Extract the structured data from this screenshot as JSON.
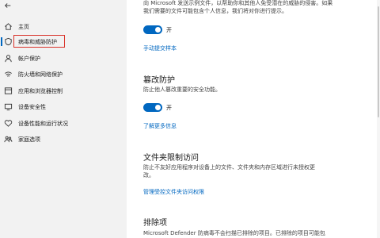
{
  "sidebar": {
    "items": [
      {
        "label": "主页",
        "icon": "home-icon"
      },
      {
        "label": "病毒和威胁防护",
        "icon": "shield-icon"
      },
      {
        "label": "帐户保护",
        "icon": "person-icon"
      },
      {
        "label": "防火墙和网络保护",
        "icon": "wifi-icon"
      },
      {
        "label": "应用和浏览器控制",
        "icon": "app-window-icon"
      },
      {
        "label": "设备安全性",
        "icon": "device-icon"
      },
      {
        "label": "设备性能和运行状况",
        "icon": "heart-icon"
      },
      {
        "label": "家庭选项",
        "icon": "family-icon"
      }
    ],
    "active_index": 1
  },
  "main": {
    "sample_desc_line1": "向 Microsoft 发送示例文件，以帮助你和其他人免受潜在的威胁的侵害。如果",
    "sample_desc_line2": "我们需要的文件可能包含个人信息，我们将对你进行提示。",
    "sample_toggle_label": "开",
    "sample_link": "手动提交样本",
    "tamper_title": "篡改防护",
    "tamper_desc": "防止他人篡改重要的安全功能。",
    "tamper_toggle_label": "开",
    "tamper_link": "了解更多信息",
    "folder_title": "文件夹限制访问",
    "folder_desc_line1": "防止不友好应用程序对设备上的文件、文件夹和内存区域进行未授权更",
    "folder_desc_line2": "改。",
    "folder_link": "管理受控文件夹访问权限",
    "exclusions_title": "排除项",
    "exclusions_desc": "Microsoft Defender 防病毒不会扫描已排除的项目。已排除的项目可能包"
  },
  "colors": {
    "accent": "#0067c0",
    "highlight": "#d9332a",
    "sidebar_bg": "#f2f2f2"
  }
}
